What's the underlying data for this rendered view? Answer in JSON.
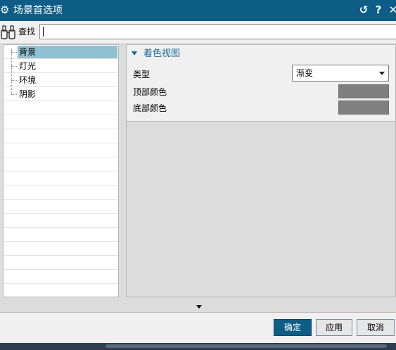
{
  "window": {
    "title": "场景首选项",
    "icons": {
      "app": "gear-icon",
      "reset": "reset-icon",
      "help": "help-icon",
      "close": "close-icon"
    },
    "glyphs": {
      "app": "⚙",
      "reset": "↺",
      "help": "?",
      "close": "✕"
    }
  },
  "search": {
    "label": "查找",
    "value": "",
    "icon": "binoculars-icon"
  },
  "tree": {
    "items": [
      {
        "label": "背景",
        "selected": true
      },
      {
        "label": "灯光",
        "selected": false
      },
      {
        "label": "环境",
        "selected": false
      },
      {
        "label": "阴影",
        "selected": false
      }
    ]
  },
  "panel": {
    "group_title": "着色视图",
    "type_label": "类型",
    "type_value": "渐变",
    "top_color_label": "顶部颜色",
    "top_color": "#7f7f7f",
    "bottom_color_label": "底部颜色",
    "bottom_color": "#808080"
  },
  "buttons": {
    "ok": "确定",
    "apply": "应用",
    "cancel": "取消"
  },
  "colors": {
    "titlebar": "#0e5d86",
    "accent": "#1a6b96",
    "selection": "#8fc1d1"
  }
}
